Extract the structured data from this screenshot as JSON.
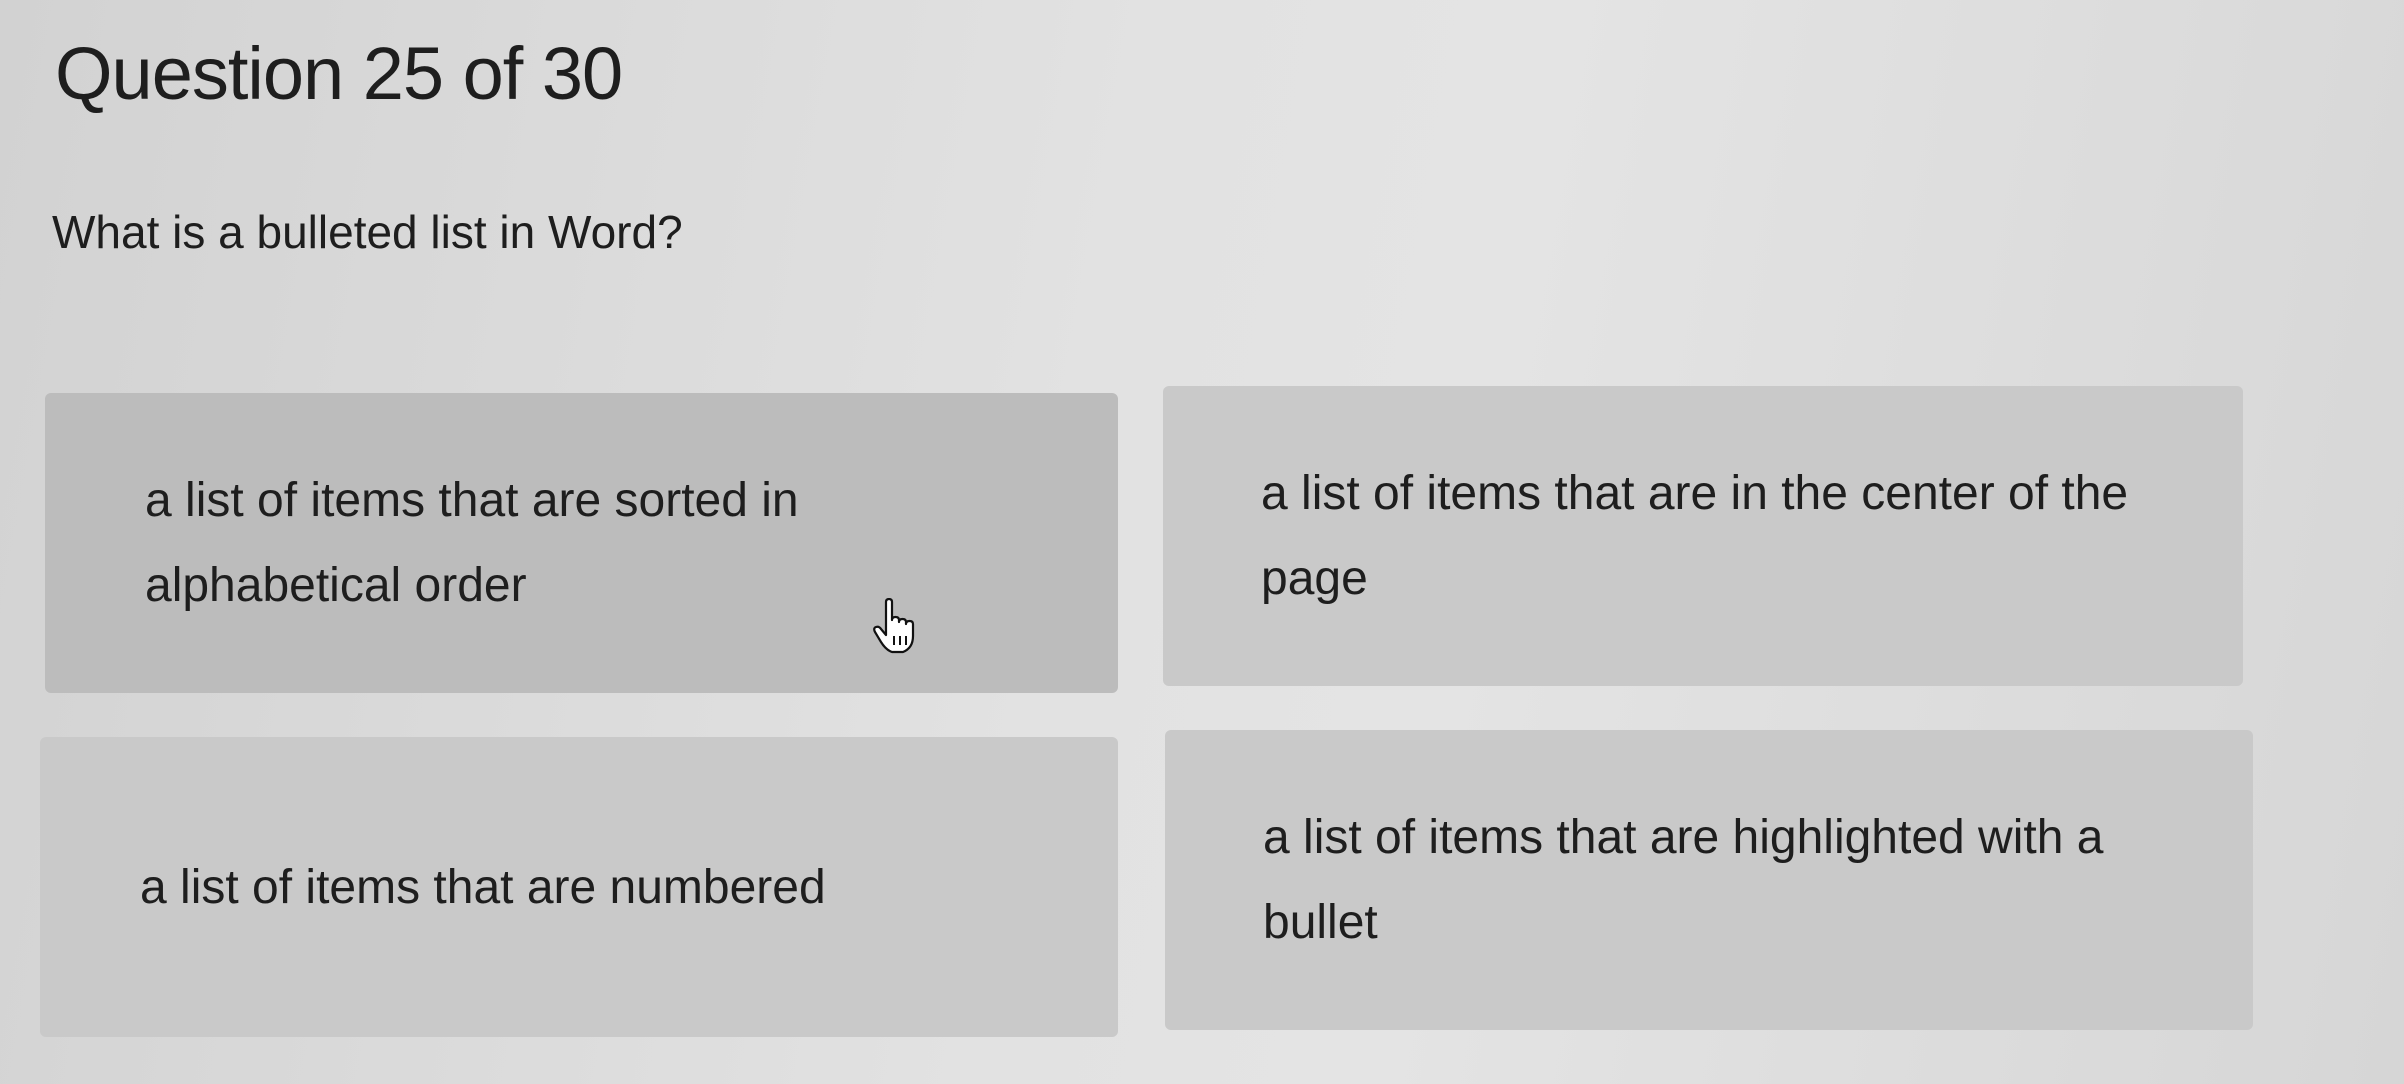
{
  "quiz": {
    "heading": "Question 25 of 30",
    "question": "What is a bulleted list in Word?",
    "answers": [
      {
        "label": "a list of items that are sorted in alphabetical order"
      },
      {
        "label": "a list of items that are in the center of the page"
      },
      {
        "label": "a list of items that are numbered"
      },
      {
        "label": "a list of items that are highlighted with a bullet"
      }
    ],
    "hovered_answer": "a list of items that are sorted in alphabetical order"
  },
  "cursor": {
    "icon": "hand-pointer-icon"
  },
  "colors": {
    "page_background": "#dcdcdc",
    "answer_background": "#c9c9c9",
    "answer_hover_background": "#bcbcbc",
    "text": "#1e1e1e"
  }
}
